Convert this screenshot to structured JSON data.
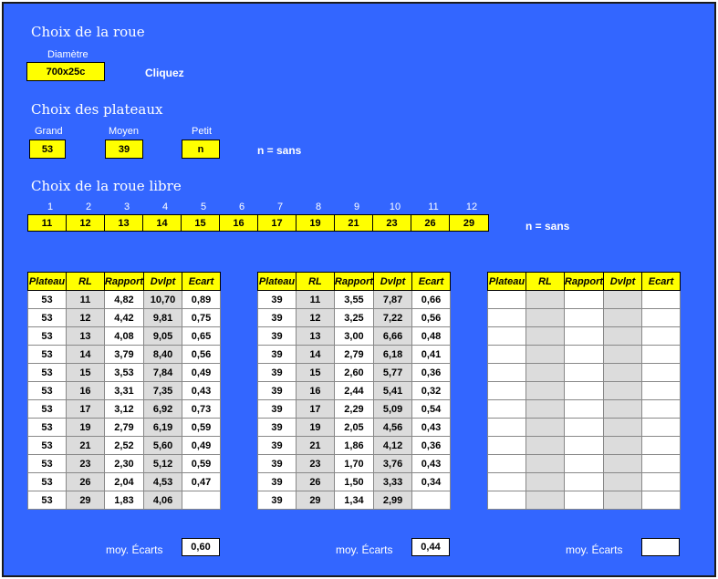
{
  "roue": {
    "title": "Choix de la roue",
    "diam_label": "Diamètre",
    "diam_value": "700x25c",
    "cliquez": "Cliquez"
  },
  "plateaux": {
    "title": "Choix des plateaux",
    "grand_label": "Grand",
    "grand_value": "53",
    "moyen_label": "Moyen",
    "moyen_value": "39",
    "petit_label": "Petit",
    "petit_value": "n",
    "note": "n = sans"
  },
  "roue_libre": {
    "title": "Choix de la roue libre",
    "indexes": [
      "1",
      "2",
      "3",
      "4",
      "5",
      "6",
      "7",
      "8",
      "9",
      "10",
      "11",
      "12"
    ],
    "values": [
      "11",
      "12",
      "13",
      "14",
      "15",
      "16",
      "17",
      "19",
      "21",
      "23",
      "26",
      "29"
    ],
    "note": "n = sans"
  },
  "headers": [
    "Plateau",
    "RL",
    "Rapport",
    "Dvlpt",
    "Ecart"
  ],
  "tables": [
    {
      "rows": [
        [
          "53",
          "11",
          "4,82",
          "10,70",
          "0,89"
        ],
        [
          "53",
          "12",
          "4,42",
          "9,81",
          "0,75"
        ],
        [
          "53",
          "13",
          "4,08",
          "9,05",
          "0,65"
        ],
        [
          "53",
          "14",
          "3,79",
          "8,40",
          "0,56"
        ],
        [
          "53",
          "15",
          "3,53",
          "7,84",
          "0,49"
        ],
        [
          "53",
          "16",
          "3,31",
          "7,35",
          "0,43"
        ],
        [
          "53",
          "17",
          "3,12",
          "6,92",
          "0,73"
        ],
        [
          "53",
          "19",
          "2,79",
          "6,19",
          "0,59"
        ],
        [
          "53",
          "21",
          "2,52",
          "5,60",
          "0,49"
        ],
        [
          "53",
          "23",
          "2,30",
          "5,12",
          "0,59"
        ],
        [
          "53",
          "26",
          "2,04",
          "4,53",
          "0,47"
        ],
        [
          "53",
          "29",
          "1,83",
          "4,06",
          ""
        ]
      ],
      "moy_label": "moy. Écarts",
      "moy_value": "0,60"
    },
    {
      "rows": [
        [
          "39",
          "11",
          "3,55",
          "7,87",
          "0,66"
        ],
        [
          "39",
          "12",
          "3,25",
          "7,22",
          "0,56"
        ],
        [
          "39",
          "13",
          "3,00",
          "6,66",
          "0,48"
        ],
        [
          "39",
          "14",
          "2,79",
          "6,18",
          "0,41"
        ],
        [
          "39",
          "15",
          "2,60",
          "5,77",
          "0,36"
        ],
        [
          "39",
          "16",
          "2,44",
          "5,41",
          "0,32"
        ],
        [
          "39",
          "17",
          "2,29",
          "5,09",
          "0,54"
        ],
        [
          "39",
          "19",
          "2,05",
          "4,56",
          "0,43"
        ],
        [
          "39",
          "21",
          "1,86",
          "4,12",
          "0,36"
        ],
        [
          "39",
          "23",
          "1,70",
          "3,76",
          "0,43"
        ],
        [
          "39",
          "26",
          "1,50",
          "3,33",
          "0,34"
        ],
        [
          "39",
          "29",
          "1,34",
          "2,99",
          ""
        ]
      ],
      "moy_label": "moy. Écarts",
      "moy_value": "0,44"
    },
    {
      "rows": [
        [
          "",
          "",
          "",
          "",
          ""
        ],
        [
          "",
          "",
          "",
          "",
          ""
        ],
        [
          "",
          "",
          "",
          "",
          ""
        ],
        [
          "",
          "",
          "",
          "",
          ""
        ],
        [
          "",
          "",
          "",
          "",
          ""
        ],
        [
          "",
          "",
          "",
          "",
          ""
        ],
        [
          "",
          "",
          "",
          "",
          ""
        ],
        [
          "",
          "",
          "",
          "",
          ""
        ],
        [
          "",
          "",
          "",
          "",
          ""
        ],
        [
          "",
          "",
          "",
          "",
          ""
        ],
        [
          "",
          "",
          "",
          "",
          ""
        ],
        [
          "",
          "",
          "",
          "",
          ""
        ]
      ],
      "moy_label": "moy. Écarts",
      "moy_value": ""
    }
  ]
}
